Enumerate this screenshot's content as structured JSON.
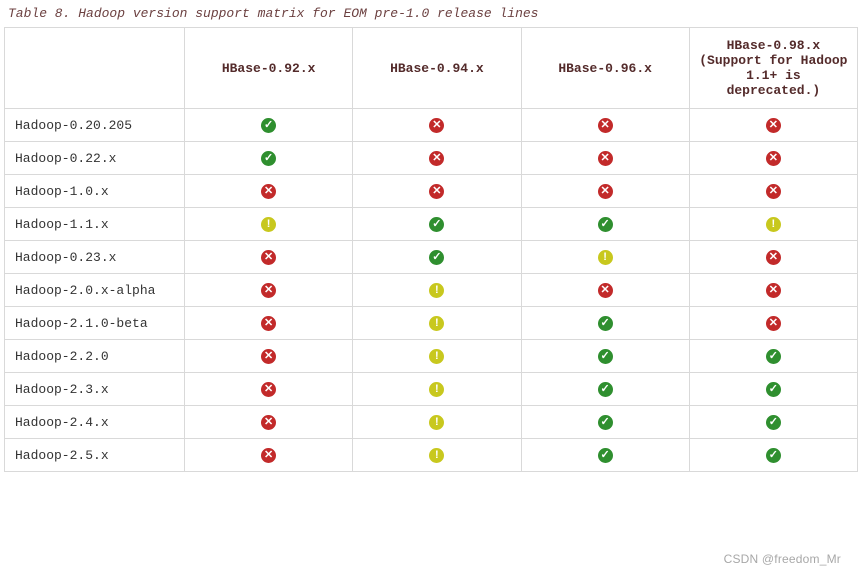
{
  "caption": "Table 8. Hadoop version support matrix for EOM pre-1.0 release lines",
  "columns": [
    "HBase-0.92.x",
    "HBase-0.94.x",
    "HBase-0.96.x",
    "HBase-0.98.x (Support for Hadoop 1.1+ is deprecated.)"
  ],
  "rows": [
    {
      "label": "Hadoop-0.20.205",
      "cells": [
        "ok",
        "no",
        "no",
        "no"
      ]
    },
    {
      "label": "Hadoop-0.22.x",
      "cells": [
        "ok",
        "no",
        "no",
        "no"
      ]
    },
    {
      "label": "Hadoop-1.0.x",
      "cells": [
        "no",
        "no",
        "no",
        "no"
      ]
    },
    {
      "label": "Hadoop-1.1.x",
      "cells": [
        "warn",
        "ok",
        "ok",
        "warn"
      ]
    },
    {
      "label": "Hadoop-0.23.x",
      "cells": [
        "no",
        "ok",
        "warn",
        "no"
      ]
    },
    {
      "label": "Hadoop-2.0.x-alpha",
      "cells": [
        "no",
        "warn",
        "no",
        "no"
      ]
    },
    {
      "label": "Hadoop-2.1.0-beta",
      "cells": [
        "no",
        "warn",
        "ok",
        "no"
      ]
    },
    {
      "label": "Hadoop-2.2.0",
      "cells": [
        "no",
        "warn",
        "ok",
        "ok"
      ]
    },
    {
      "label": "Hadoop-2.3.x",
      "cells": [
        "no",
        "warn",
        "ok",
        "ok"
      ]
    },
    {
      "label": "Hadoop-2.4.x",
      "cells": [
        "no",
        "warn",
        "ok",
        "ok"
      ]
    },
    {
      "label": "Hadoop-2.5.x",
      "cells": [
        "no",
        "warn",
        "ok",
        "ok"
      ]
    }
  ],
  "glyphs": {
    "ok": "✓",
    "no": "✕",
    "warn": "!"
  },
  "watermark": "CSDN @freedom_Mr"
}
